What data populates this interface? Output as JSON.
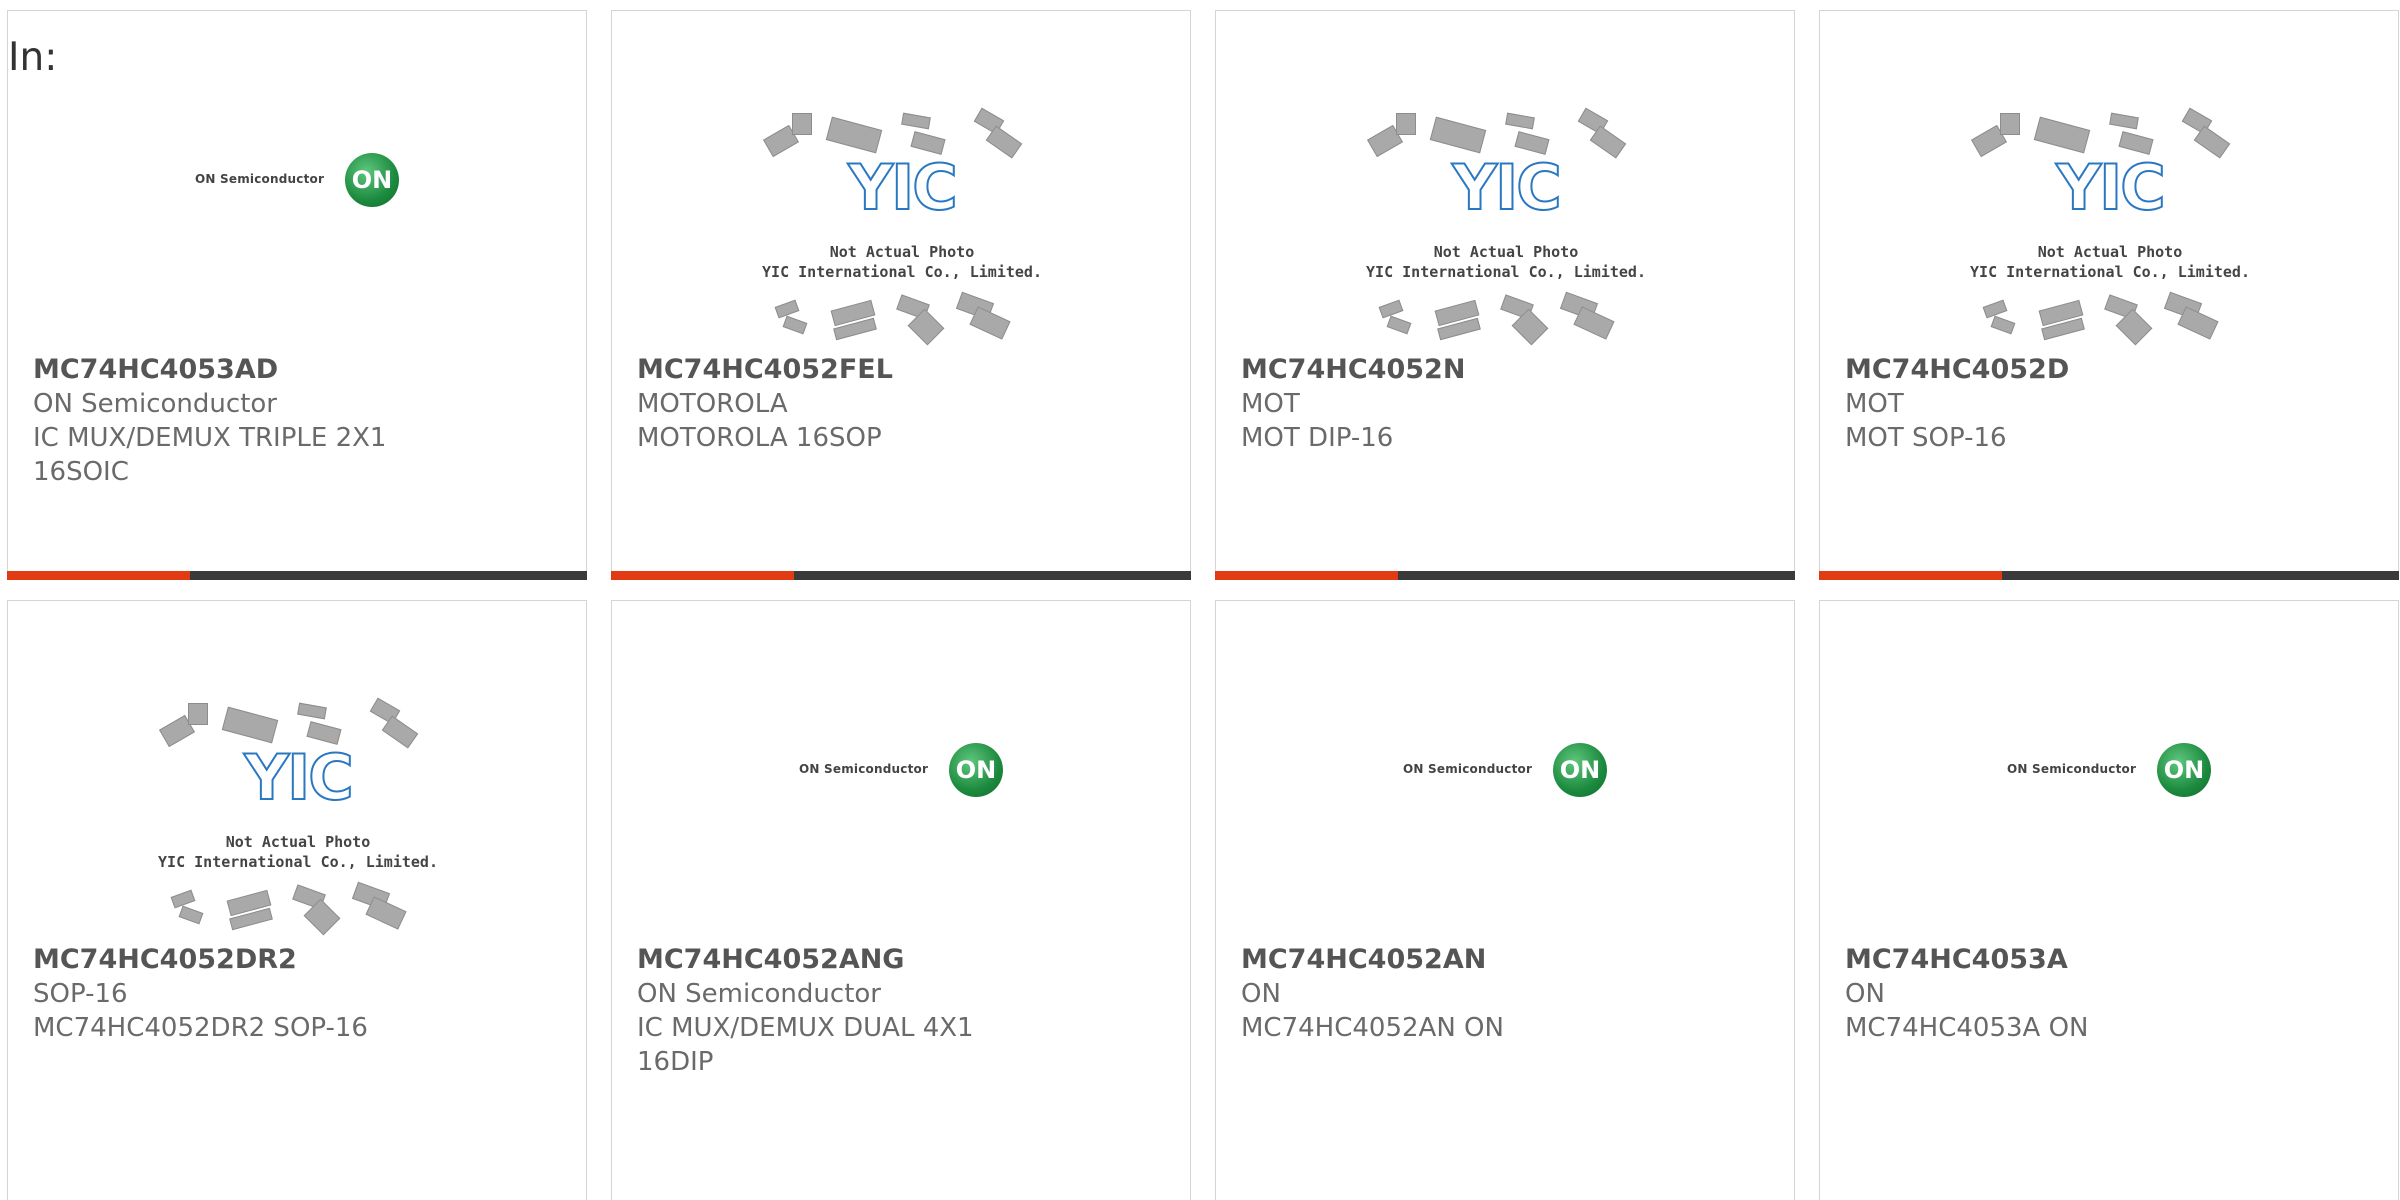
{
  "heading": "In:",
  "cards": [
    {
      "part": "MC74HC4053AD",
      "maker": "ON Semiconductor",
      "desc": "IC MUX/DEMUX TRIPLE 2X1",
      "desc2": "16SOIC",
      "image": "on-semiconductor-logo"
    },
    {
      "part": "MC74HC4052FEL",
      "maker": "MOTOROLA",
      "desc": "MOTOROLA 16SOP",
      "desc2": "",
      "image": "yic-not-actual-photo"
    },
    {
      "part": "MC74HC4052N",
      "maker": "MOT",
      "desc": "MOT DIP-16",
      "desc2": "",
      "image": "yic-not-actual-photo"
    },
    {
      "part": "MC74HC4052D",
      "maker": "MOT",
      "desc": "MOT SOP-16",
      "desc2": "",
      "image": "yic-not-actual-photo"
    },
    {
      "part": "MC74HC4052DR2",
      "maker": "SOP-16",
      "desc": "MC74HC4052DR2 SOP-16",
      "desc2": "",
      "image": "yic-not-actual-photo"
    },
    {
      "part": "MC74HC4052ANG",
      "maker": "ON Semiconductor",
      "desc": "IC MUX/DEMUX DUAL 4X1 16DIP",
      "desc2": "",
      "image": "on-semiconductor-logo"
    },
    {
      "part": "MC74HC4052AN",
      "maker": "ON",
      "desc": "MC74HC4052AN ON",
      "desc2": "",
      "image": "on-semiconductor-logo"
    },
    {
      "part": "MC74HC4053A",
      "maker": "ON",
      "desc": "MC74HC4053A ON",
      "desc2": "",
      "image": "on-semiconductor-logo"
    }
  ],
  "logo_on": {
    "brand": "ON Semiconductor",
    "mark": "ON"
  },
  "logo_yic": {
    "mark": "YIC",
    "caption1": "Not Actual Photo",
    "caption2": "YIC International Co., Limited."
  },
  "colors": {
    "accent": "#e13b14",
    "bar": "#3a3a3a",
    "on_green": "#1c8a3e",
    "yic_blue": "#2a78c2"
  }
}
